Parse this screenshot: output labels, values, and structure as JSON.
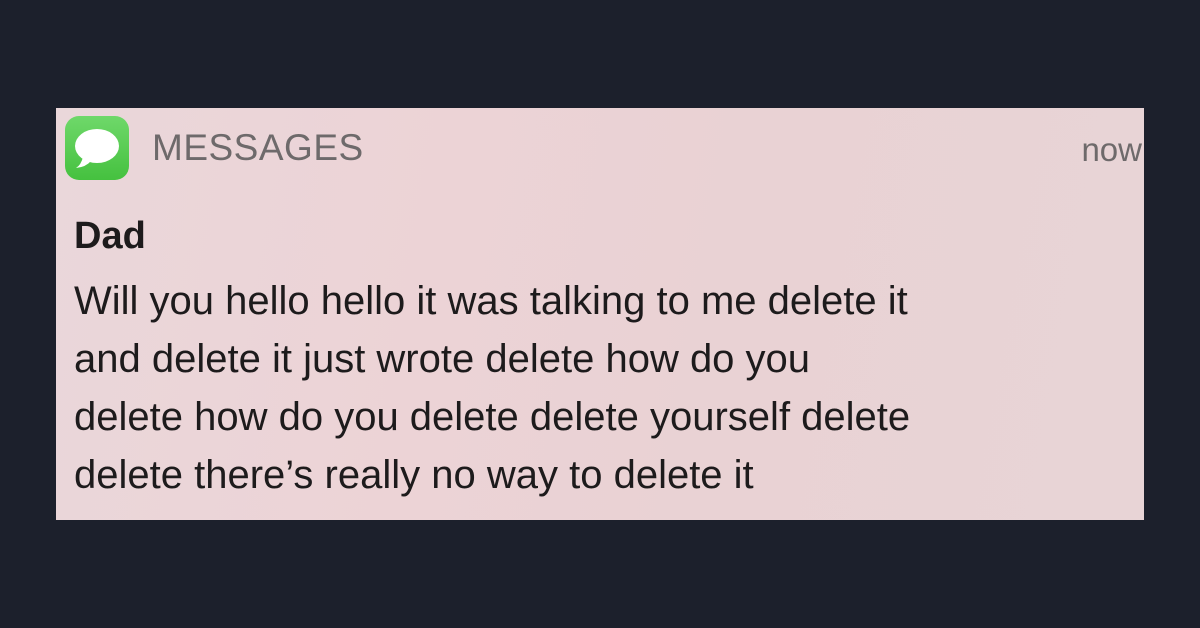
{
  "notification": {
    "app_name": "MESSAGES",
    "app_icon": "messages-bubble-icon",
    "app_icon_color": "#4cc646",
    "timestamp": "now",
    "sender": "Dad",
    "message_lines": [
      "Will you hello hello it was talking to me delete it",
      "and delete it just wrote delete how do you",
      "delete how do you delete delete yourself delete",
      "delete there’s really no way to delete it"
    ]
  },
  "colors": {
    "page_background": "#1c202c",
    "banner_background": "#ead4d7",
    "text_primary": "#1d1b1c",
    "text_secondary": "#6e6a6b"
  }
}
